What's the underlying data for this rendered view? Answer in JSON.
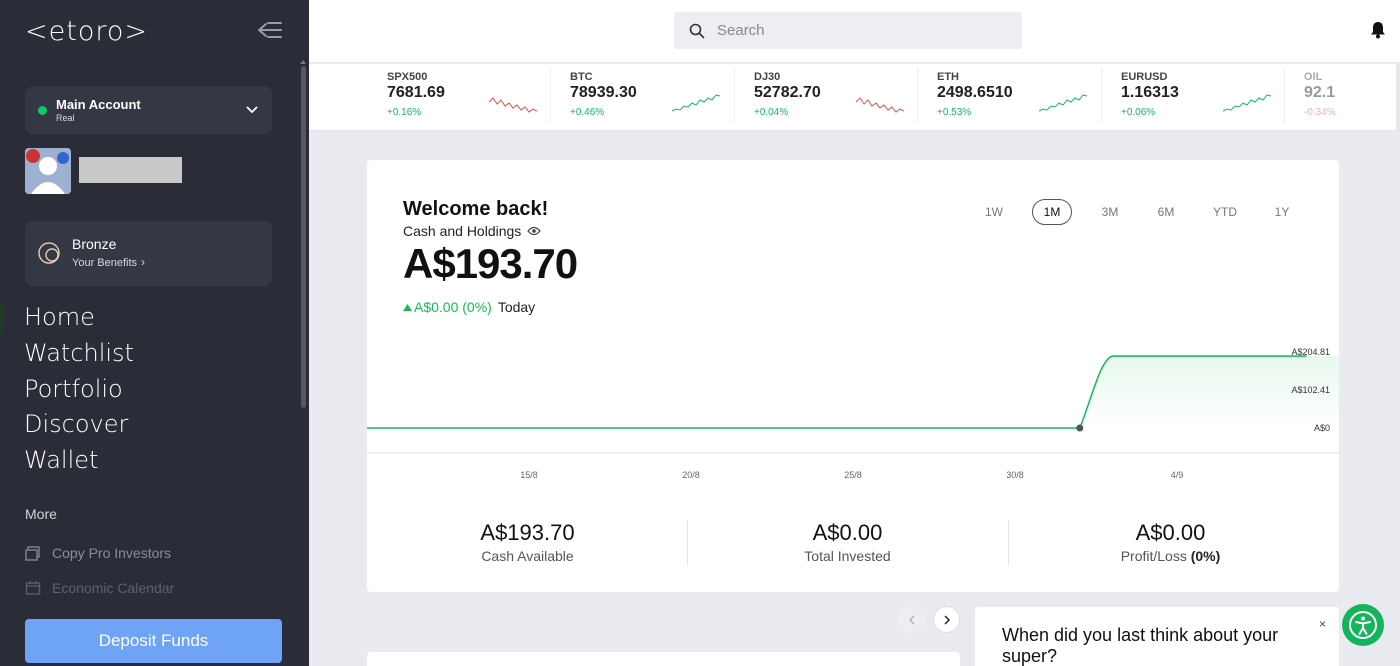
{
  "brand": {
    "logo_text": "<etoro>"
  },
  "sidebar": {
    "account": {
      "name": "Main Account",
      "type": "Real"
    },
    "club": {
      "tier": "Bronze",
      "link": "Your Benefits"
    },
    "nav": [
      "Home",
      "Watchlist",
      "Portfolio",
      "Discover",
      "Wallet"
    ],
    "more_label": "More",
    "more_items": [
      {
        "label": "Copy Pro Investors",
        "icon": "copy-investors-icon"
      },
      {
        "label": "Economic Calendar",
        "icon": "calendar-icon"
      }
    ],
    "deposit_label": "Deposit Funds"
  },
  "search": {
    "placeholder": "Search"
  },
  "ticker": [
    {
      "symbol": "SPX500",
      "price": "7681.69",
      "change": "+0.16%",
      "trend": "down"
    },
    {
      "symbol": "BTC",
      "price": "78939.30",
      "change": "+0.46%",
      "trend": "up"
    },
    {
      "symbol": "DJ30",
      "price": "52782.70",
      "change": "+0.04%",
      "trend": "down"
    },
    {
      "symbol": "ETH",
      "price": "2498.6510",
      "change": "+0.53%",
      "trend": "up"
    },
    {
      "symbol": "EURUSD",
      "price": "1.16313",
      "change": "+0.06%",
      "trend": "up"
    },
    {
      "symbol": "OIL",
      "price": "92.1",
      "change": "-0.34%",
      "trend": "down"
    }
  ],
  "colors": {
    "up": "#17b858",
    "down": "#e04f4f",
    "accent": "#6ea3f5",
    "sidebar": "#2a2d37"
  },
  "overview": {
    "welcome": "Welcome back!",
    "cash_label": "Cash and Holdings",
    "amount": "A$193.70",
    "daily_change": "A$0.00 (0%)",
    "daily_label": "Today",
    "periods": [
      "1W",
      "1M",
      "3M",
      "6M",
      "YTD",
      "1Y"
    ],
    "active_period": "1M",
    "stats": [
      {
        "value": "A$193.70",
        "label": "Cash Available",
        "extra": ""
      },
      {
        "value": "A$0.00",
        "label": "Total Invested",
        "extra": ""
      },
      {
        "value": "A$0.00",
        "label": "Profit/Loss",
        "extra": "(0%)"
      }
    ]
  },
  "chart_data": {
    "type": "line",
    "x_ticks": [
      "15/8",
      "20/8",
      "25/8",
      "30/8",
      "4/9"
    ],
    "y_ticks": [
      "A$204.81",
      "A$102.41",
      "A$0"
    ],
    "ylim": [
      0,
      204.81
    ],
    "series": [
      {
        "values": [
          {
            "x": "11/8",
            "y": 0
          },
          {
            "x": "2/9",
            "y": 0
          },
          {
            "x": "3/9",
            "y": 193.7
          },
          {
            "x": "9/9",
            "y": 193.7
          }
        ]
      }
    ],
    "marker": {
      "x": "2/9",
      "y": 0
    },
    "grid": false
  },
  "promo": {
    "text": "When did you last think about your super?",
    "close": "×"
  }
}
